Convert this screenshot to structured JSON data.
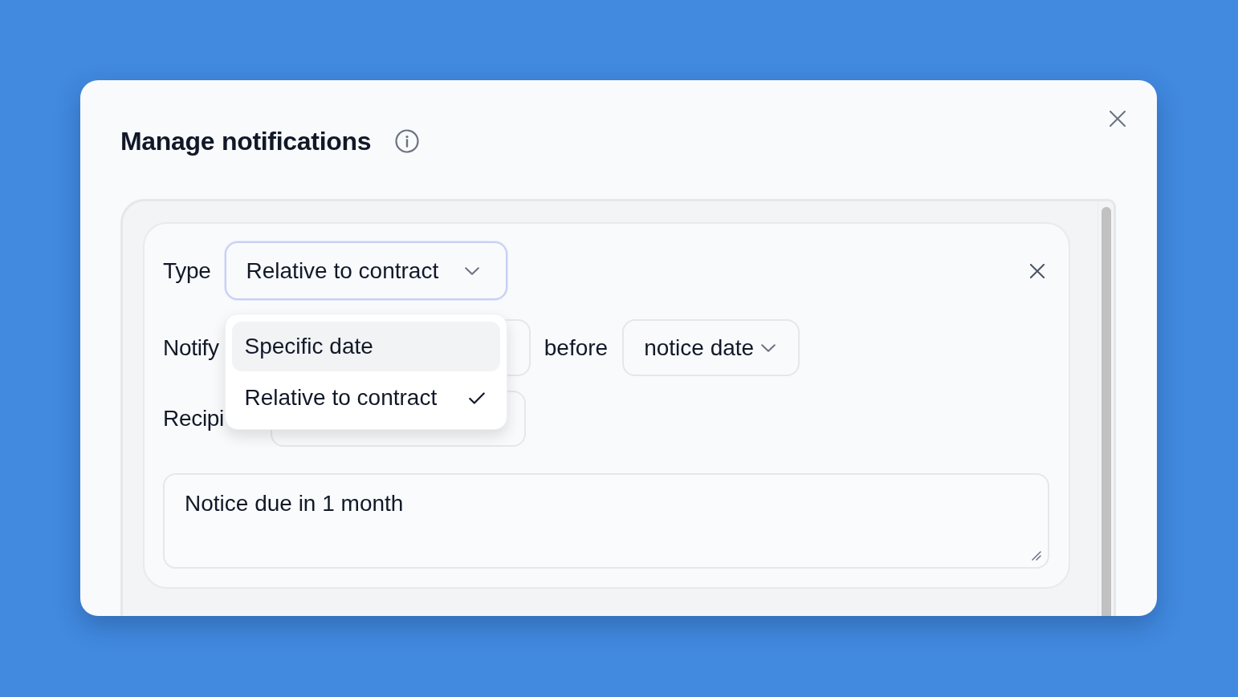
{
  "dialog": {
    "title": "Manage notifications"
  },
  "notification": {
    "type_label": "Type",
    "type_select": {
      "value": "Relative to contract",
      "expanded": true
    },
    "type_options": [
      {
        "label": "Specific date",
        "selected": false,
        "highlighted": true
      },
      {
        "label": "Relative to contract",
        "selected": true,
        "highlighted": false
      }
    ],
    "notify_label": "Notify",
    "before_text": "before",
    "anchor_select": {
      "value": "notice date"
    },
    "recipients_label": "Recipi",
    "message": "Notice due in 1 month"
  }
}
